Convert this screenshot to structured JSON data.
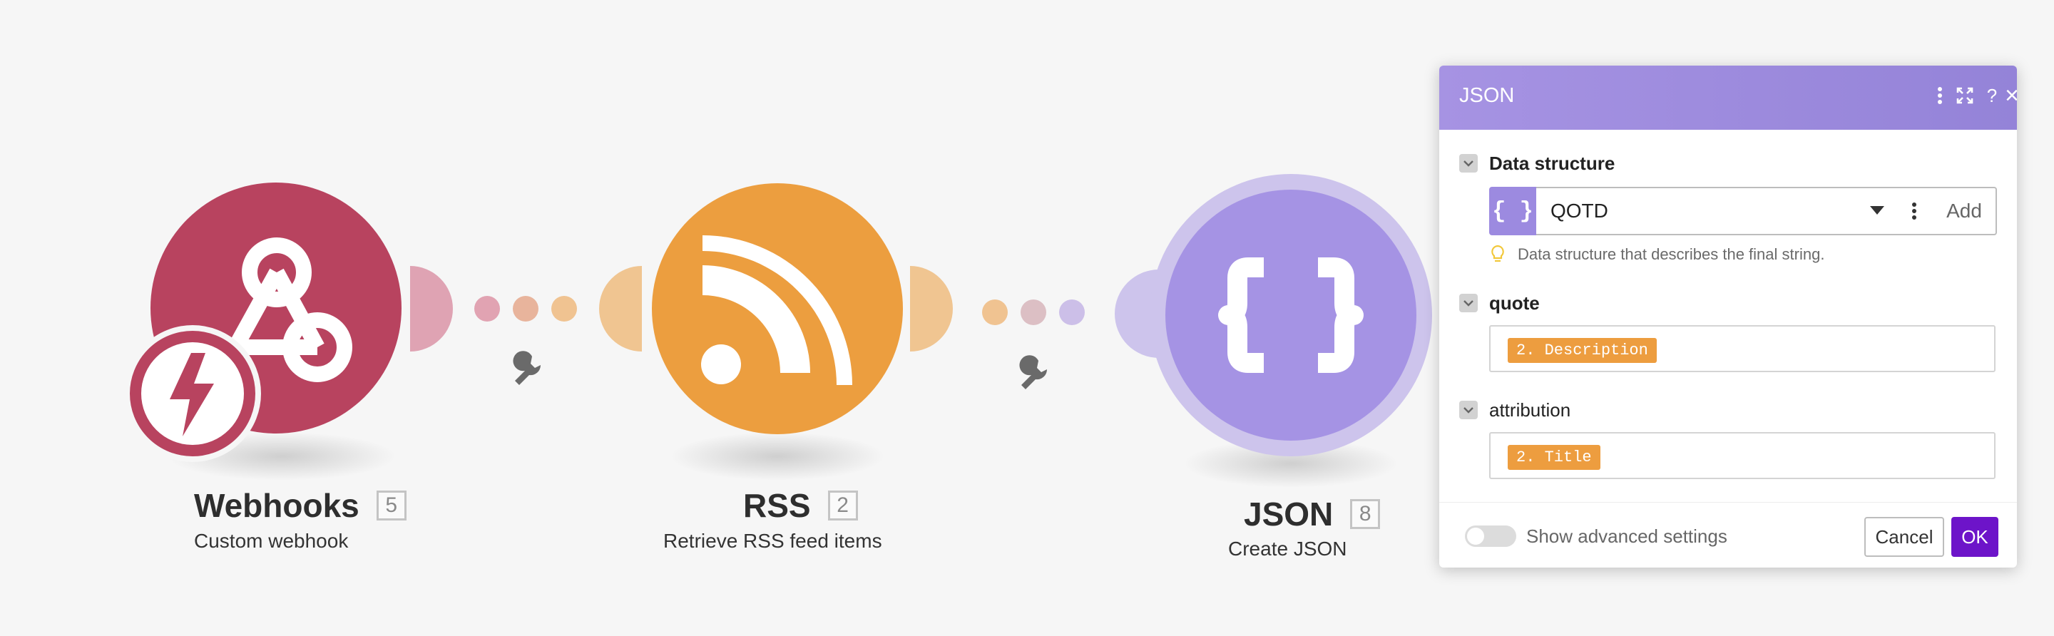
{
  "modules": [
    {
      "name": "Webhooks",
      "count": "5",
      "subtitle": "Custom webhook",
      "color": "#b8435f"
    },
    {
      "name": "RSS",
      "count": "2",
      "subtitle": "Retrieve RSS feed items",
      "color": "#ec9e3f"
    },
    {
      "name": "JSON",
      "count": "8",
      "subtitle": "Create JSON",
      "color": "#a593e4"
    }
  ],
  "panel": {
    "title": "JSON",
    "header_icons": [
      "more-vertical-icon",
      "expand-icon",
      "help-icon",
      "close-icon"
    ],
    "help_glyph": "?",
    "close_glyph": "×",
    "data_structure": {
      "label": "Data structure",
      "icon_glyph": "{ }",
      "value": "QOTD",
      "add_label": "Add",
      "hint": "Data structure that describes the final string."
    },
    "fields": [
      {
        "label": "quote",
        "pill": "2. Description"
      },
      {
        "label": "attribution",
        "pill": "2. Title"
      }
    ],
    "footer": {
      "advanced_label": "Show advanced settings",
      "cancel_label": "Cancel",
      "ok_label": "OK"
    }
  },
  "colors": {
    "webhooks": "#b8435f",
    "rss": "#ec9e3f",
    "json": "#a593e4",
    "ok_button": "#6d14c9",
    "pill": "#ed9d3f"
  }
}
